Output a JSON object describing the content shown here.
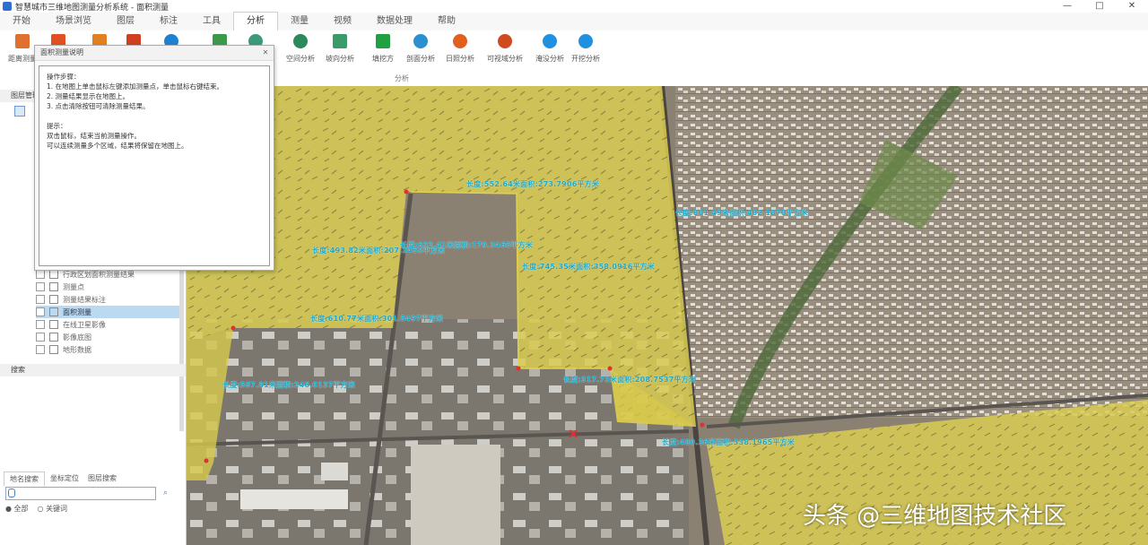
{
  "window": {
    "title": "智慧城市三维地图测量分析系统 - 面积测量",
    "controls": [
      "—",
      "□",
      "✕"
    ]
  },
  "menu": {
    "tabs": [
      "开始",
      "场景浏览",
      "图层",
      "标注",
      "工具",
      "分析",
      "测量",
      "视频",
      "数据处理",
      "帮助"
    ],
    "active_index": 5
  },
  "ribbon": {
    "buttons": [
      {
        "label": "距离测量",
        "icon": "ruler-icon",
        "color": "#e07030"
      },
      {
        "label": "面积",
        "icon": "area-icon",
        "color": "#e05020"
      },
      {
        "label": "",
        "icon": "triangle-icon",
        "color": "#e08020"
      },
      {
        "label": "",
        "icon": "cloud-icon",
        "color": "#d04020"
      },
      {
        "label": "",
        "icon": "drop-icon",
        "color": "#2080d0"
      },
      {
        "label": "",
        "icon": "pen-icon",
        "color": "#3a9a4a"
      },
      {
        "label": "",
        "icon": "ring-icon",
        "color": "#3a9a7a"
      },
      {
        "label": "空间分析",
        "icon": "globe-icon",
        "color": "#2a8a5a"
      },
      {
        "label": "坡向分析",
        "icon": "slope-icon",
        "color": "#3a9a6a"
      },
      {
        "label": "填挖方",
        "icon": "cutfill-icon",
        "color": "#20a040"
      },
      {
        "label": "剖面分析",
        "icon": "profile-icon",
        "color": "#2a90d0"
      },
      {
        "label": "日照分析",
        "icon": "sun-icon",
        "color": "#e06020"
      },
      {
        "label": "可视域分析",
        "icon": "view-icon",
        "color": "#d04a20"
      },
      {
        "label": "淹没分析",
        "icon": "flood-icon",
        "color": "#2090e0"
      },
      {
        "label": "开挖分析",
        "icon": "excavate-icon",
        "color": "#2090e0"
      }
    ],
    "group_label": "分析"
  },
  "left_panel": {
    "header": "图层管理",
    "layers": [
      {
        "label": "行政区划面积测量结果",
        "selected": false
      },
      {
        "label": "测量点",
        "selected": false
      },
      {
        "label": "测量结果标注",
        "selected": false
      },
      {
        "label": "面积测量",
        "selected": true
      },
      {
        "label": "在线卫星影像",
        "selected": false
      },
      {
        "label": "影像底图",
        "selected": false
      },
      {
        "label": "地形数据",
        "selected": false
      }
    ],
    "search_header": "搜索",
    "search_tabs": [
      "地名搜索",
      "坐标定位",
      "图层搜索"
    ],
    "search_options": [
      "全部",
      "关键词"
    ]
  },
  "popup": {
    "title": "面积测量说明",
    "lines": [
      "操作步骤：",
      "1. 在地图上单击鼠标左键添加测量点，单击鼠标右键结束。",
      "2. 测量结果显示在地图上。",
      "3. 点击清除按钮可清除测量结果。",
      "",
      "提示：",
      "双击鼠标，结束当前测量操作。",
      "可以连续测量多个区域，结果将保留在地图上。"
    ]
  },
  "map": {
    "measurements": [
      "长度:552.64米面积:273.7906平方米",
      "长度:493.82米面积:207.3458平方米",
      "长度:632.41米面积:179.3468平方米",
      "长度:745.35米面积:358.0916平方米",
      "长度:610.77米面积:301.5497平方米",
      "长度:801.49米面积:402.1870平方米",
      "长度:317.73米面积:208.7537平方米",
      "长度:567.81米面积:246.0137平方米",
      "长度:480.36米面积:338.1965平方米"
    ],
    "watermark": "头条 @三维地图技术社区"
  }
}
